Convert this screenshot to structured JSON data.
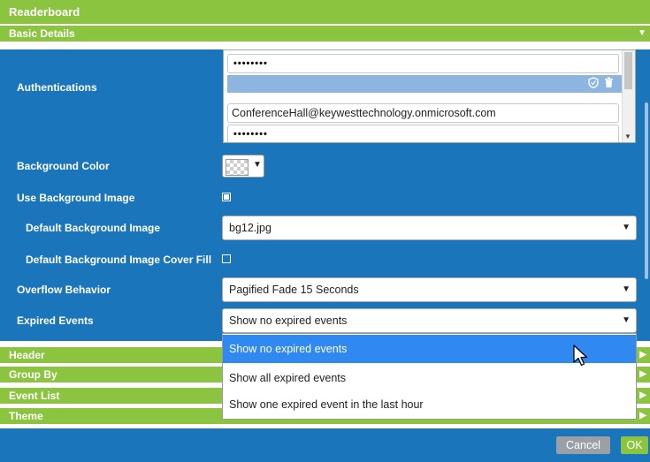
{
  "window": {
    "title": "Readerboard"
  },
  "sections": {
    "basic_details": "Basic Details",
    "header": "Header",
    "group_by": "Group By",
    "event_list": "Event List",
    "theme": "Theme"
  },
  "fields": {
    "authentications_label": "Authentications",
    "password_mask_1": "••••••••",
    "email": "ConferenceHall@keywesttechnology.onmicrosoft.com",
    "password_mask_2": "••••••••",
    "background_color_label": "Background Color",
    "use_background_image_label": "Use Background Image",
    "use_background_image_checked": true,
    "default_background_image_label": "Default Background Image",
    "default_background_image_value": "bg12.jpg",
    "cover_fill_label": "Default Background Image Cover Fill",
    "cover_fill_checked": false,
    "overflow_behavior_label": "Overflow Behavior",
    "overflow_behavior_value": "Pagified Fade 15 Seconds",
    "expired_events_label": "Expired Events",
    "expired_events_value": "Show no expired events"
  },
  "expired_events_options": [
    "Show no expired events",
    "Show all expired events",
    "Show one expired event in the last hour"
  ],
  "buttons": {
    "cancel": "Cancel",
    "ok": "OK"
  },
  "icons": {
    "collapse": "triangle-down-icon",
    "expand": "triangle-right-icon",
    "shield": "shield-icon",
    "trash": "trash-icon",
    "cursor": "mouse-pointer-icon"
  },
  "colors": {
    "accent_green": "#8bc43f",
    "panel_blue": "#1b75bb",
    "selected_option": "#2f89f0",
    "cancel_grey": "#9aa0a6"
  }
}
